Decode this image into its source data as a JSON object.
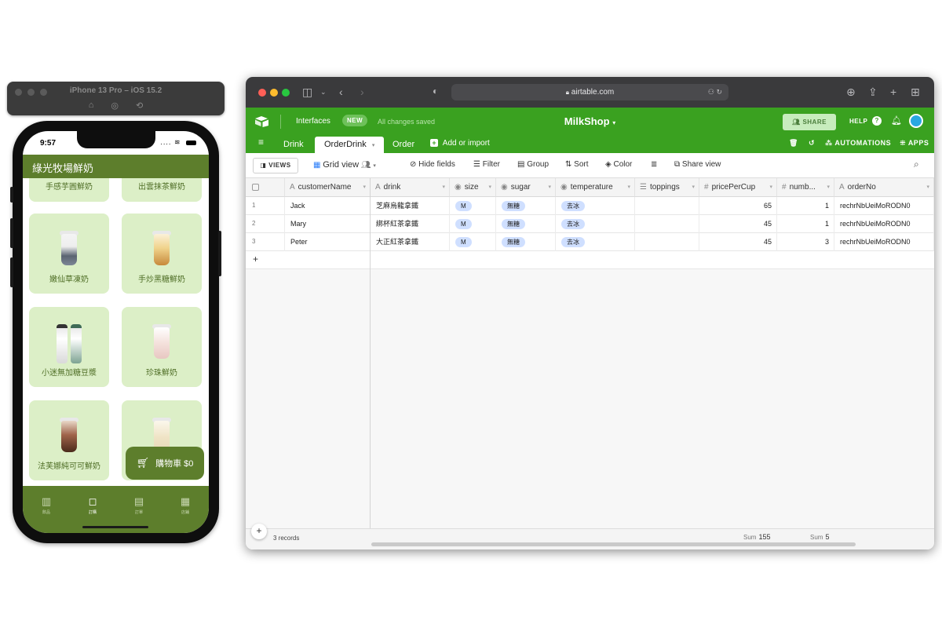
{
  "simulator": {
    "title": "iPhone 13 Pro – iOS 15.2"
  },
  "phone": {
    "status_time": "9:57",
    "app_title": "綠光牧場鮮奶",
    "products": [
      {
        "name": "手感芋圓鮮奶",
        "cup_color": "#c6a98c"
      },
      {
        "name": "出雲抹茶鮮奶",
        "cup_color": "#a9c28a"
      },
      {
        "name": "嫩仙草凍奶",
        "cup_color": "#5b6472"
      },
      {
        "name": "手炒黑糖鮮奶",
        "cup_color": "#c7893b"
      },
      {
        "name": "小迷無加糖豆漿",
        "cup_color": "#7ea392"
      },
      {
        "name": "珍珠鮮奶",
        "cup_color": "#e8c7c2"
      },
      {
        "name": "法芙娜純可可鮮奶",
        "cup_color": "#6b3f2a"
      },
      {
        "name": "",
        "cup_color": "#e6d9b8"
      }
    ],
    "cart_label": "購物車 $0",
    "tabs": [
      {
        "label": "飲品",
        "icon": "cup-icon"
      },
      {
        "label": "訂購",
        "icon": "bag-icon"
      },
      {
        "label": "訂單",
        "icon": "list-icon"
      },
      {
        "label": "店鋪",
        "icon": "store-icon"
      }
    ]
  },
  "browser": {
    "url": "airtable.com"
  },
  "airtable": {
    "interfaces_label": "Interfaces",
    "new_badge": "NEW",
    "saved_status": "All changes saved",
    "base_name": "MilkShop",
    "share_label": "SHARE",
    "help_label": "HELP",
    "table_tabs": [
      "Drink",
      "OrderDrink",
      "Order"
    ],
    "active_tab": "OrderDrink",
    "add_import_label": "Add or import",
    "automations_label": "AUTOMATIONS",
    "apps_label": "APPS",
    "views_label": "VIEWS",
    "view_name": "Grid view",
    "toolbar": {
      "hide_fields": "Hide fields",
      "filter": "Filter",
      "group": "Group",
      "sort": "Sort",
      "color": "Color",
      "share_view": "Share view"
    },
    "columns": [
      {
        "label": "customerName",
        "icon": "A"
      },
      {
        "label": "drink",
        "icon": "A"
      },
      {
        "label": "size",
        "icon": "◉"
      },
      {
        "label": "sugar",
        "icon": "◉"
      },
      {
        "label": "temperature",
        "icon": "◉"
      },
      {
        "label": "toppings",
        "icon": "☰"
      },
      {
        "label": "pricePerCup",
        "icon": "#"
      },
      {
        "label": "numb...",
        "icon": "#"
      },
      {
        "label": "orderNo",
        "icon": "A"
      }
    ],
    "rows": [
      {
        "n": "1",
        "customerName": "Jack",
        "drink": "芝麻烏龍拿鐵",
        "size": "M",
        "sugar": "無糖",
        "temperature": "去冰",
        "toppings": "",
        "pricePerCup": "65",
        "number": "1",
        "orderNo": "rechrNbUeiMoRODN0"
      },
      {
        "n": "2",
        "customerName": "Mary",
        "drink": "綁杯紅茶拿鐵",
        "size": "M",
        "sugar": "無糖",
        "temperature": "去冰",
        "toppings": "",
        "pricePerCup": "45",
        "number": "1",
        "orderNo": "rechrNbUeiMoRODN0"
      },
      {
        "n": "3",
        "customerName": "Peter",
        "drink": "大正紅茶拿鐵",
        "size": "M",
        "sugar": "無糖",
        "temperature": "去冰",
        "toppings": "",
        "pricePerCup": "45",
        "number": "3",
        "orderNo": "rechrNbUeiMoRODN0"
      }
    ],
    "footer": {
      "records": "3 records",
      "sum_label": "Sum",
      "sum_price": "155",
      "sum_number": "5"
    },
    "colors": {
      "brand_green": "#3aa120",
      "app_green": "#5d7e2c",
      "pill_blue": "#cfdfff"
    }
  }
}
